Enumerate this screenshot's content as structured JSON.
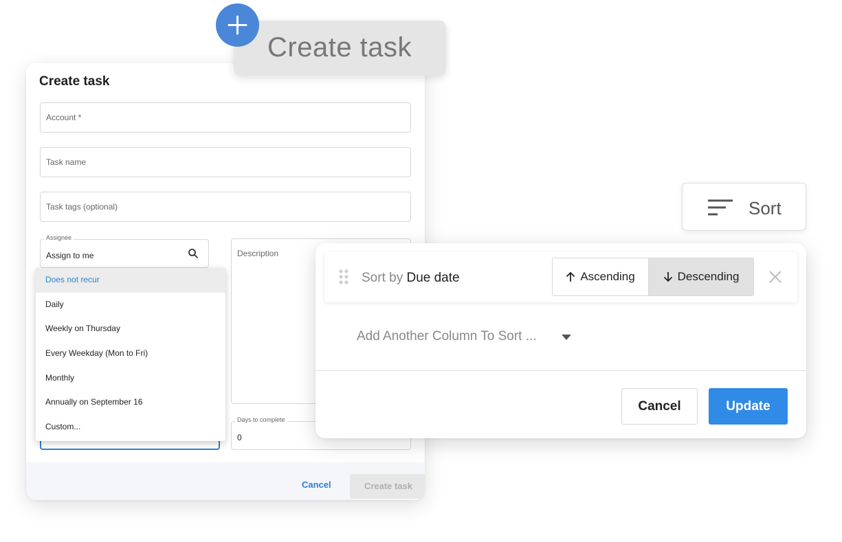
{
  "create_task_dialog": {
    "title": "Create task",
    "account_placeholder": "Account *",
    "task_name_placeholder": "Task name",
    "task_tags_placeholder": "Task tags (optional)",
    "assignee_label": "Assignee",
    "assignee_value": "Assign to me",
    "description_placeholder": "Description",
    "days_to_complete_label": "Days to complete",
    "days_to_complete_value": "0",
    "recurrence_options": [
      "Does not recur",
      "Daily",
      "Weekly on Thursday",
      "Every Weekday (Mon to Fri)",
      "Monthly",
      "Annually on September 16",
      "Custom..."
    ],
    "recurrence_selected": "Does not recur",
    "cancel_label": "Cancel",
    "create_label": "Create task"
  },
  "create_chip": {
    "label": "Create task",
    "icon": "plus-icon"
  },
  "sort_button": {
    "label": "Sort",
    "icon": "sort-lines-icon"
  },
  "sort_panel": {
    "sort_by_prefix": "Sort by",
    "sort_by_column": "Due date",
    "ascending_label": "Ascending",
    "descending_label": "Descending",
    "selected_direction": "Descending",
    "add_column_placeholder": "Add Another Column To Sort ...",
    "cancel_label": "Cancel",
    "update_label": "Update"
  },
  "colors": {
    "accent_blue": "#2f8be6",
    "link_blue": "#2f7fd0",
    "plus_circle": "#4b87d8"
  }
}
